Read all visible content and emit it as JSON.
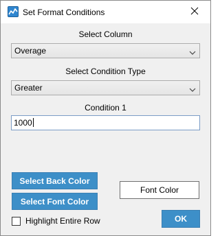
{
  "window": {
    "title": "Set Format Conditions",
    "icon": "chart-line-icon",
    "close_icon": "close-icon"
  },
  "column": {
    "label": "Select Column",
    "selected": "Overage"
  },
  "condition_type": {
    "label": "Select Condition Type",
    "selected": "Greater"
  },
  "condition1": {
    "label": "Condition 1",
    "value": "1000"
  },
  "buttons": {
    "back_color": "Select Back Color",
    "font_color_select": "Select Font Color",
    "font_color_preview": "Font Color",
    "ok": "OK"
  },
  "highlight_row": {
    "label": "Highlight Entire Row",
    "checked": false
  },
  "colors": {
    "accent": "#3d8fc8",
    "dialog_bg": "#f0f0f0"
  }
}
